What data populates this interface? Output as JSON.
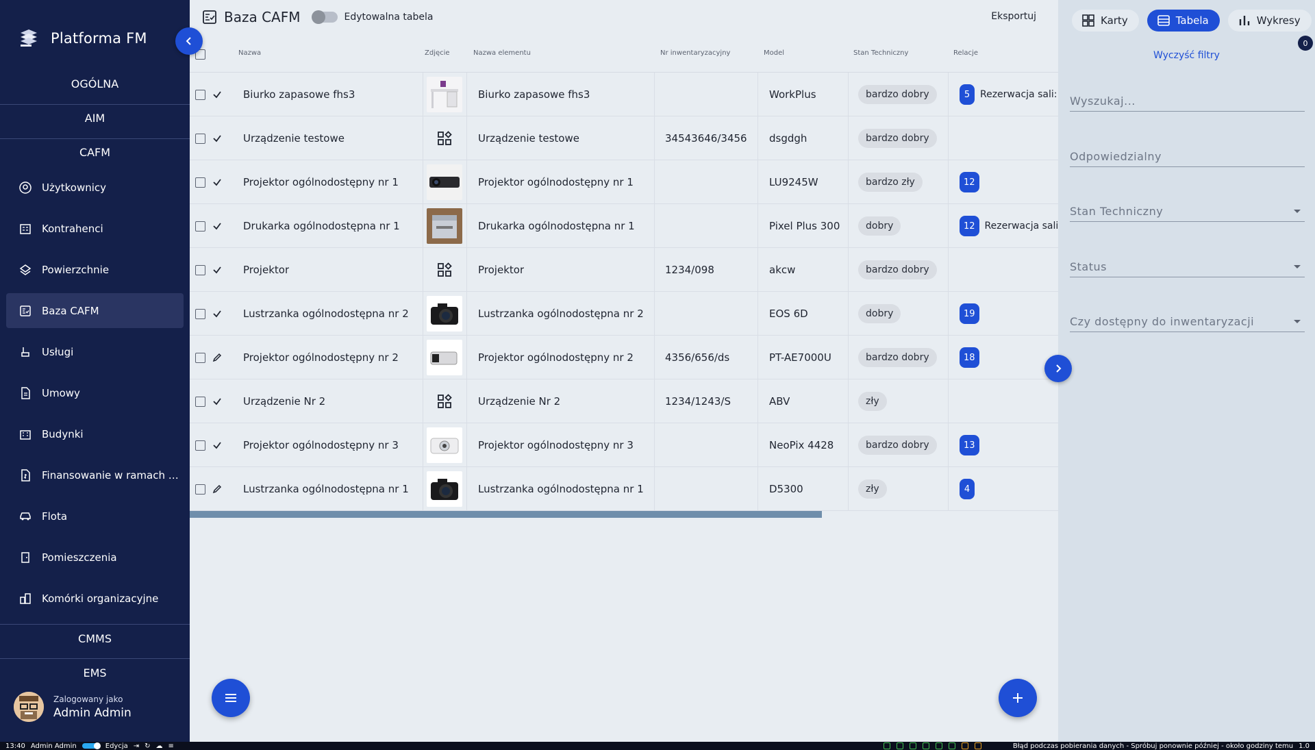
{
  "app": {
    "name": "Platforma FM"
  },
  "sidebar": {
    "sections": [
      "OGÓLNA",
      "AIM",
      "CAFM",
      "CMMS",
      "EMS"
    ],
    "items": [
      {
        "label": "Użytkownicy",
        "icon": "users-icon"
      },
      {
        "label": "Kontrahenci",
        "icon": "contractors-icon"
      },
      {
        "label": "Powierzchnie",
        "icon": "layers-icon"
      },
      {
        "label": "Baza CAFM",
        "icon": "database-icon",
        "active": true
      },
      {
        "label": "Usługi",
        "icon": "services-icon"
      },
      {
        "label": "Umowy",
        "icon": "document-icon"
      },
      {
        "label": "Budynki",
        "icon": "building-icon"
      },
      {
        "label": "Finansowanie w ramach p...",
        "icon": "finance-icon"
      },
      {
        "label": "Flota",
        "icon": "car-icon"
      },
      {
        "label": "Pomieszczenia",
        "icon": "door-icon"
      },
      {
        "label": "Komórki organizacyjne",
        "icon": "org-icon"
      }
    ],
    "user": {
      "caption": "Zalogowany jako",
      "name": "Admin Admin"
    }
  },
  "header": {
    "title": "Baza CAFM",
    "editable_label": "Edytowalna tabela",
    "export_label": "Eksportuj"
  },
  "table": {
    "columns": [
      "Nazwa",
      "Zdjęcie",
      "Nazwa elementu",
      "Nr inwentaryzacyjny",
      "Model",
      "Stan Techniczny",
      "Relacje"
    ],
    "rows": [
      {
        "mark": "check",
        "name": "Biurko zapasowe fhs3",
        "photo": "desk",
        "element": "Biurko zapasowe fhs3",
        "inv": "",
        "model": "WorkPlus",
        "state": "bardzo dobry",
        "rel_count": "5",
        "rel_text": "Rezerwacja sali:"
      },
      {
        "mark": "check",
        "name": "Urządzenie testowe",
        "photo": "placeholder",
        "element": "Urządzenie testowe",
        "inv": "34543646/3456",
        "model": "dsgdgh",
        "state": "bardzo dobry",
        "rel_count": "",
        "rel_text": ""
      },
      {
        "mark": "check",
        "name": "Projektor ogólnodostępny nr 1",
        "photo": "projector-dark",
        "element": "Projektor ogólnodostępny nr 1",
        "inv": "",
        "model": "LU9245W",
        "state": "bardzo zły",
        "rel_count": "12",
        "rel_text": ""
      },
      {
        "mark": "check",
        "name": "Drukarka ogólnodostępna nr 1",
        "photo": "printer",
        "element": "Drukarka ogólnodostępna nr 1",
        "inv": "",
        "model": "Pixel Plus 300",
        "state": "dobry",
        "rel_count": "12",
        "rel_text": "Rezerwacja sali:"
      },
      {
        "mark": "check",
        "name": "Projektor",
        "photo": "placeholder",
        "element": "Projektor",
        "inv": "1234/098",
        "model": "akcw",
        "state": "bardzo dobry",
        "rel_count": "",
        "rel_text": ""
      },
      {
        "mark": "check",
        "name": "Lustrzanka ogólnodostępna nr 2",
        "photo": "camera",
        "element": "Lustrzanka ogólnodostępna nr 2",
        "inv": "",
        "model": "EOS 6D",
        "state": "dobry",
        "rel_count": "19",
        "rel_text": ""
      },
      {
        "mark": "edit",
        "name": "Projektor ogólnodostępny nr 2",
        "photo": "projector-light",
        "element": "Projektor ogólnodostępny nr 2",
        "inv": "4356/656/ds",
        "model": "PT-AE7000U",
        "state": "bardzo dobry",
        "rel_count": "18",
        "rel_text": ""
      },
      {
        "mark": "check",
        "name": "Urządzenie Nr 2",
        "photo": "placeholder",
        "element": "Urządzenie Nr 2",
        "inv": "1234/1243/S",
        "model": "ABV",
        "state": "zły",
        "rel_count": "",
        "rel_text": ""
      },
      {
        "mark": "check",
        "name": "Projektor ogólnodostępny nr 3",
        "photo": "projector-white",
        "element": "Projektor ogólnodostępny nr 3",
        "inv": "",
        "model": "NeoPix 4428",
        "state": "bardzo dobry",
        "rel_count": "13",
        "rel_text": ""
      },
      {
        "mark": "edit",
        "name": "Lustrzanka ogólnodostępna nr 1",
        "photo": "camera",
        "element": "Lustrzanka ogólnodostępna nr 1",
        "inv": "",
        "model": "D5300",
        "state": "zły",
        "rel_count": "4",
        "rel_text": ""
      }
    ]
  },
  "panel": {
    "tabs": [
      {
        "label": "Karty",
        "icon": "cards-icon"
      },
      {
        "label": "Tabela",
        "icon": "table-icon",
        "active": true
      },
      {
        "label": "Wykresy",
        "icon": "chart-icon"
      }
    ],
    "filter_count": "0",
    "clear_filters": "Wyczyść filtry",
    "fields": [
      {
        "label": "Wyszukaj...",
        "dropdown": false
      },
      {
        "label": "Odpowiedzialny",
        "dropdown": false
      },
      {
        "label": "Stan Techniczny",
        "dropdown": true
      },
      {
        "label": "Status",
        "dropdown": true
      },
      {
        "label": "Czy dostępny do inwentaryzacji",
        "dropdown": true
      }
    ]
  },
  "statusbar": {
    "time": "13:40",
    "user": "Admin Admin",
    "mode": "Edycja",
    "error": "Błąd podczas pobierania danych - Spróbuj ponownie później - około godziny temu",
    "version": "1.0"
  },
  "colors": {
    "sidebar": "#14204a",
    "accent": "#1f4fd6",
    "panel": "#d7e0e9",
    "background": "#e8edf2"
  }
}
